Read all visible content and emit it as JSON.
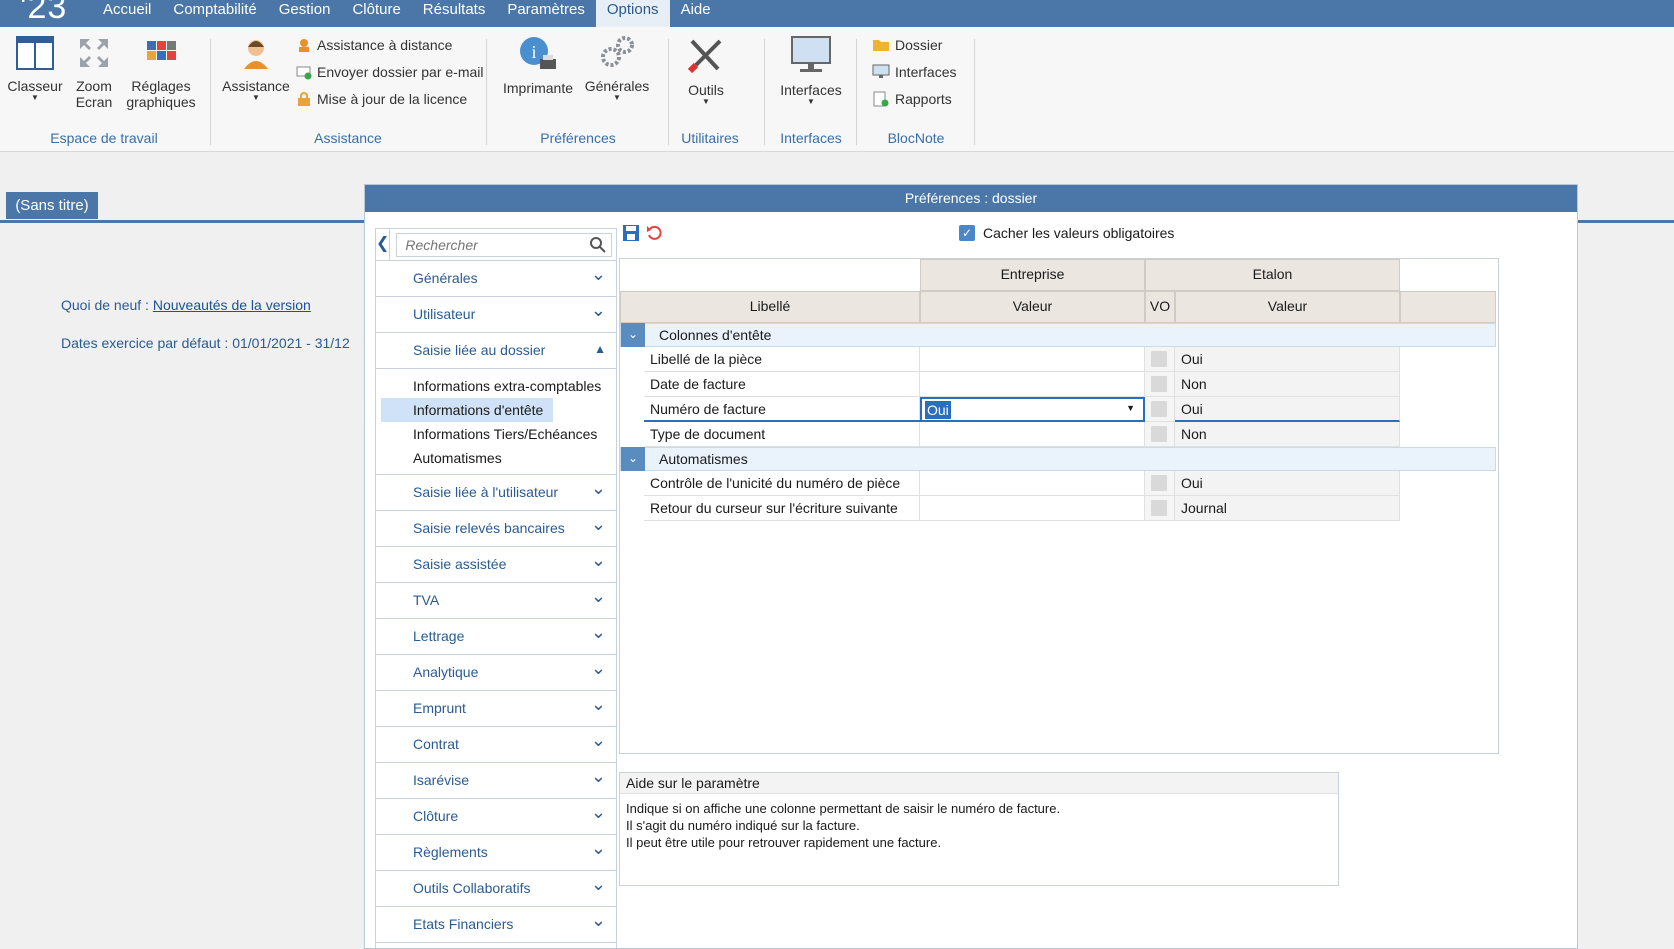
{
  "app": {
    "logo": "'23"
  },
  "menu": {
    "items": [
      "Accueil",
      "Comptabilité",
      "Gestion",
      "Clôture",
      "Résultats",
      "Paramètres",
      "Options",
      "Aide"
    ],
    "active": "Options"
  },
  "ribbon": {
    "classeur": "Classeur",
    "zoom_l1": "Zoom",
    "zoom_l2": "Ecran",
    "reglages_l1": "Réglages",
    "reglages_l2": "graphiques",
    "assistance": "Assistance",
    "assistance_distance": "Assistance à distance",
    "envoyer_dossier": "Envoyer dossier par e-mail",
    "maj_licence": "Mise à jour de la licence",
    "imprimante": "Imprimante",
    "generales": "Générales",
    "outils": "Outils",
    "interfaces": "Interfaces",
    "dossier": "Dossier",
    "interfaces_small": "Interfaces",
    "rapports": "Rapports",
    "groups": {
      "espace": "Espace de travail",
      "assistance": "Assistance",
      "preferences": "Préférences",
      "utilitaires": "Utilitaires",
      "interfaces": "Interfaces",
      "blocnote": "BlocNote"
    }
  },
  "workspace": {
    "tab": "(Sans titre)",
    "quoi_de_neuf_label": "Quoi de neuf : ",
    "quoi_de_neuf_link": "Nouveautés de la version",
    "dates_exercice": "Dates exercice par défaut : 01/01/2021 - 31/12"
  },
  "dialog": {
    "title": "Préférences : dossier",
    "search_placeholder": "Rechercher",
    "hide_mandatory": "Cacher les valeurs obligatoires",
    "nav": {
      "before": [
        "Générales",
        "Utilisateur"
      ],
      "expanded": "Saisie liée au dossier",
      "sub": [
        "Informations extra-comptables",
        "Informations d'entête",
        "Informations Tiers/Echéances",
        "Automatismes"
      ],
      "selected_sub": "Informations d'entête",
      "after": [
        "Saisie liée à l'utilisateur",
        "Saisie relevés bancaires",
        "Saisie assistée",
        "TVA",
        "Lettrage",
        "Analytique",
        "Emprunt",
        "Contrat",
        "Isarévise",
        "Clôture",
        "Règlements",
        "Outils Collaboratifs",
        "Etats Financiers"
      ]
    },
    "grid": {
      "group_entreprise": "Entreprise",
      "group_etalon": "Etalon",
      "col_libelle": "Libellé",
      "col_valeur": "Valeur",
      "col_vo": "VO",
      "col_valeur_etalon": "Valeur",
      "groups": [
        {
          "name": "Colonnes d'entête",
          "rows": [
            {
              "label": "Libellé de la pièce",
              "value": "",
              "etalon": "Oui"
            },
            {
              "label": "Date de facture",
              "value": "",
              "etalon": "Non"
            },
            {
              "label": "Numéro de facture",
              "value": "Oui",
              "etalon": "Oui",
              "editing": true
            },
            {
              "label": "Type de document",
              "value": "",
              "etalon": "Non"
            }
          ]
        },
        {
          "name": "Automatismes",
          "rows": [
            {
              "label": "Contrôle de l'unicité du numéro de pièce",
              "value": "",
              "etalon": "Oui"
            },
            {
              "label": "Retour du curseur sur l'écriture suivante",
              "value": "",
              "etalon": "Journal"
            }
          ]
        }
      ]
    },
    "help": {
      "title": "Aide sur le paramètre",
      "lines": [
        "Indique si on affiche une colonne permettant de saisir le numéro de facture.",
        "Il s'agit du numéro indiqué sur la facture.",
        "Il peut être utile pour retrouver rapidement une facture."
      ]
    }
  },
  "colors": {
    "accent": "#4a76a8",
    "link": "#2a5b93",
    "selection": "#cfe2f7"
  }
}
